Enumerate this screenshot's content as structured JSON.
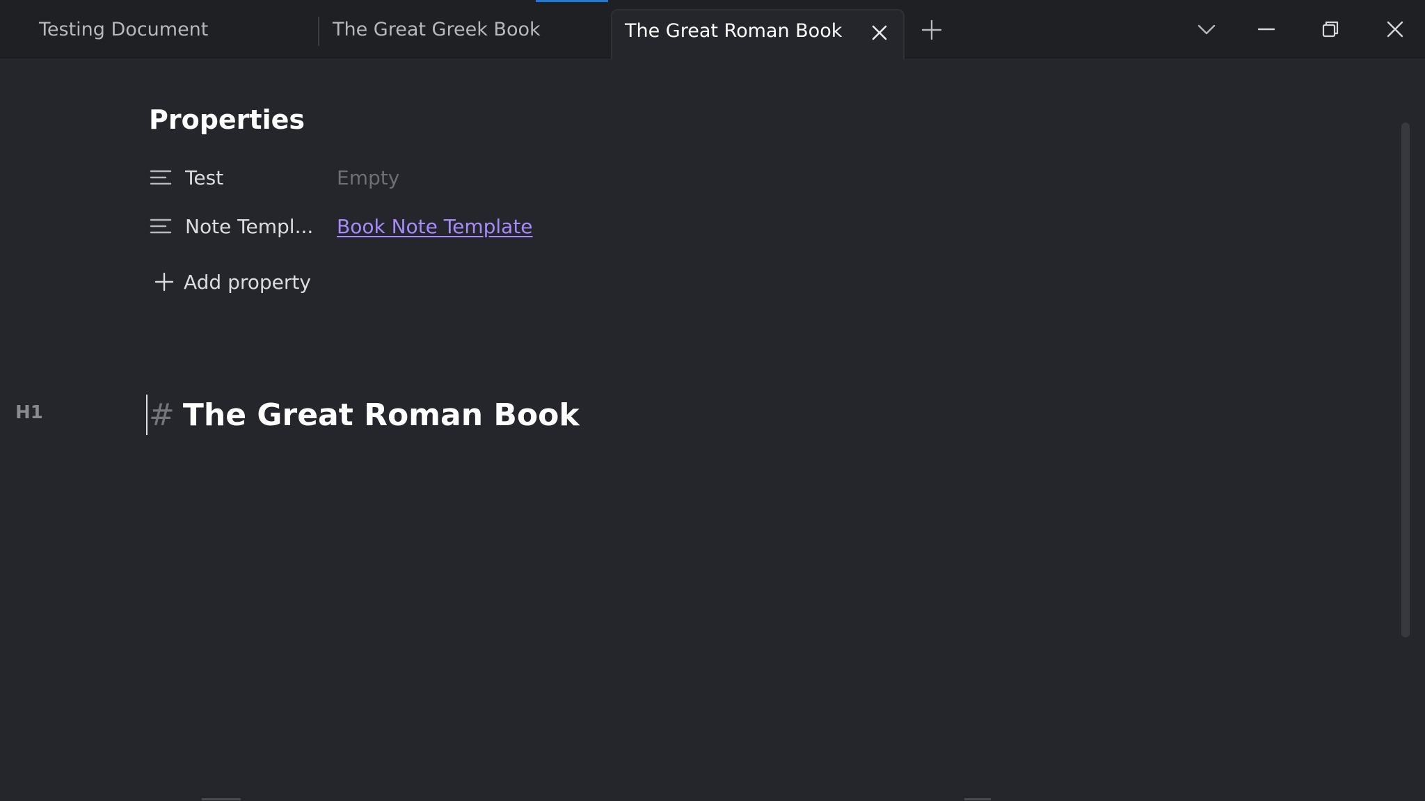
{
  "tabs": [
    {
      "label": "Testing Document",
      "active": false
    },
    {
      "label": "The Great Greek Book",
      "active": false
    },
    {
      "label": "The Great Roman Book",
      "active": true
    }
  ],
  "icons": {
    "tab_close": "close-icon",
    "new_tab": "plus-icon",
    "tab_list": "chevron-down-icon",
    "minimize": "minimize-icon",
    "maximize": "restore-icon",
    "close_window": "close-icon",
    "property_type": "text-lines-icon",
    "add_property": "plus-icon"
  },
  "properties": {
    "heading": "Properties",
    "items": [
      {
        "key": "Test",
        "value": "Empty",
        "value_kind": "placeholder"
      },
      {
        "key": "Note Templ...",
        "value": "Book Note Template",
        "value_kind": "link"
      }
    ],
    "add_label": "Add property"
  },
  "editor": {
    "gutter_label": "H1",
    "heading_marker": "#",
    "heading_text": "The Great Roman Book"
  },
  "colors": {
    "accent": "#1e7ad8",
    "link": "#a88bfa",
    "background": "#25262b",
    "titlebar": "#1f2024"
  }
}
